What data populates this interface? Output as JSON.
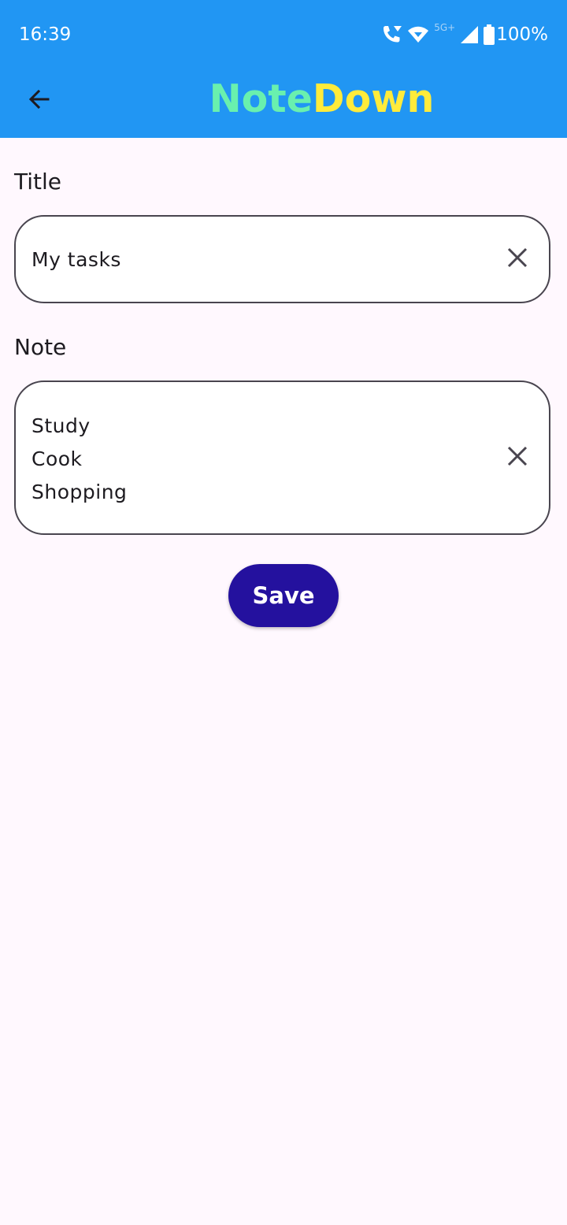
{
  "status_bar": {
    "time": "16:39",
    "network": "5G+",
    "battery": "100%",
    "icons": [
      "wifi-calling-icon",
      "wifi-icon",
      "cellular-signal-icon",
      "battery-icon"
    ]
  },
  "app_bar": {
    "back_icon": "arrow-left-icon",
    "title_part1": "Note",
    "title_part2": "Down",
    "title_color_1": "#69F0AE",
    "title_color_2": "#FFEB3B",
    "background_color": "#2196F3"
  },
  "form": {
    "title_label": "Title",
    "title_value": "My tasks",
    "note_label": "Note",
    "note_lines": [
      "Study",
      "Cook",
      "Shopping"
    ],
    "clear_icon": "close-icon"
  },
  "actions": {
    "save_label": "Save",
    "save_color": "#24119E"
  }
}
